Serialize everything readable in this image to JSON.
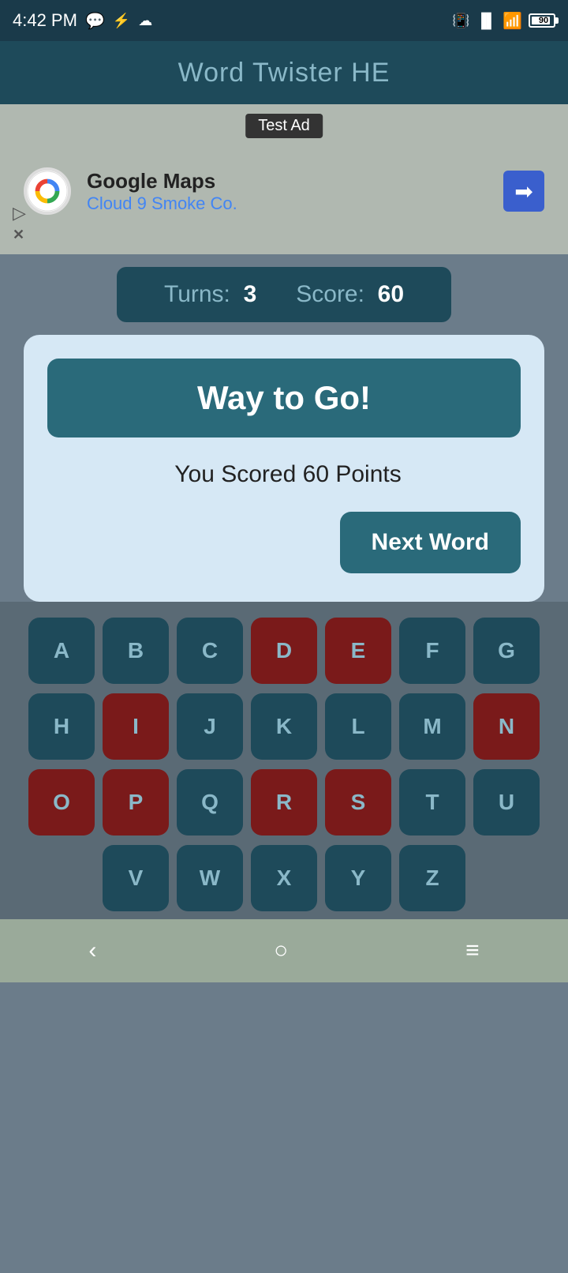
{
  "statusBar": {
    "time": "4:42 PM",
    "battery": "90"
  },
  "header": {
    "title": "Word Twister HE"
  },
  "ad": {
    "label": "Test Ad",
    "company": "Google Maps",
    "subtitle": "Cloud 9 Smoke Co."
  },
  "stats": {
    "turns_label": "Turns:",
    "turns_value": "3",
    "score_label": "Score:",
    "score_value": "60"
  },
  "dialog": {
    "title": "Way to Go!",
    "score_text": "You Scored 60 Points",
    "next_btn": "Next Word"
  },
  "keyboard": {
    "rows": [
      [
        {
          "letter": "A",
          "used": false
        },
        {
          "letter": "B",
          "used": false
        },
        {
          "letter": "C",
          "used": false
        },
        {
          "letter": "D",
          "used": true
        },
        {
          "letter": "E",
          "used": true
        },
        {
          "letter": "F",
          "used": false
        },
        {
          "letter": "G",
          "used": false
        }
      ],
      [
        {
          "letter": "H",
          "used": false
        },
        {
          "letter": "I",
          "used": true
        },
        {
          "letter": "J",
          "used": false
        },
        {
          "letter": "K",
          "used": false
        },
        {
          "letter": "L",
          "used": false
        },
        {
          "letter": "M",
          "used": false
        },
        {
          "letter": "N",
          "used": true
        }
      ],
      [
        {
          "letter": "O",
          "used": true
        },
        {
          "letter": "P",
          "used": true
        },
        {
          "letter": "Q",
          "used": false
        },
        {
          "letter": "R",
          "used": true
        },
        {
          "letter": "S",
          "used": true
        },
        {
          "letter": "T",
          "used": false
        },
        {
          "letter": "U",
          "used": false
        }
      ],
      [
        {
          "letter": "V",
          "used": false
        },
        {
          "letter": "W",
          "used": false
        },
        {
          "letter": "X",
          "used": false
        },
        {
          "letter": "Y",
          "used": false
        },
        {
          "letter": "Z",
          "used": false
        }
      ]
    ]
  },
  "navbar": {
    "back": "‹",
    "home": "○",
    "menu": "≡"
  }
}
